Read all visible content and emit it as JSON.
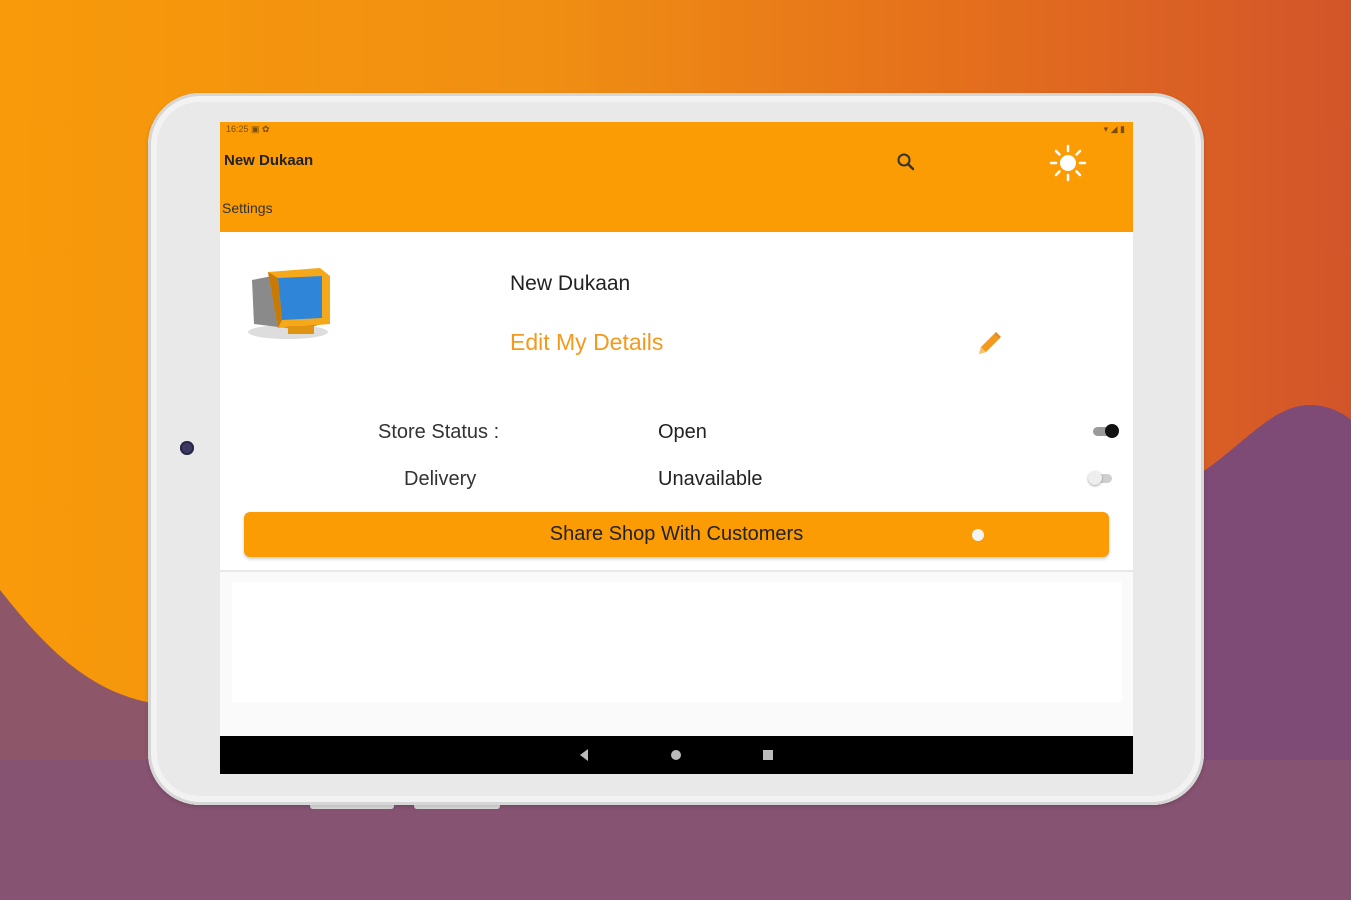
{
  "colors": {
    "accent": "#fb9c04",
    "link": "#f39a1e",
    "navbar": "#000000"
  },
  "statusbar": {
    "time": "16:25",
    "icons_left": "▣ ✿",
    "icons_right": "▾ ◢ ▮"
  },
  "appbar": {
    "title": "New Dukaan",
    "subtitle": "Settings",
    "search_icon": "search-icon",
    "brightness_icon": "brightness-icon"
  },
  "profile": {
    "avatar_icon": "computer-monitor-icon",
    "shop_name": "New Dukaan",
    "edit_label": "Edit My Details",
    "edit_icon": "pencil-icon"
  },
  "store_status": {
    "label": "Store Status :",
    "value": "Open",
    "enabled": true
  },
  "delivery": {
    "label": "Delivery",
    "value": "Unavailable",
    "enabled": false
  },
  "share_button": {
    "label": "Share Shop With Customers"
  },
  "navbar": {
    "back_icon": "back-icon",
    "home_icon": "home-icon",
    "recents_icon": "recents-icon"
  }
}
